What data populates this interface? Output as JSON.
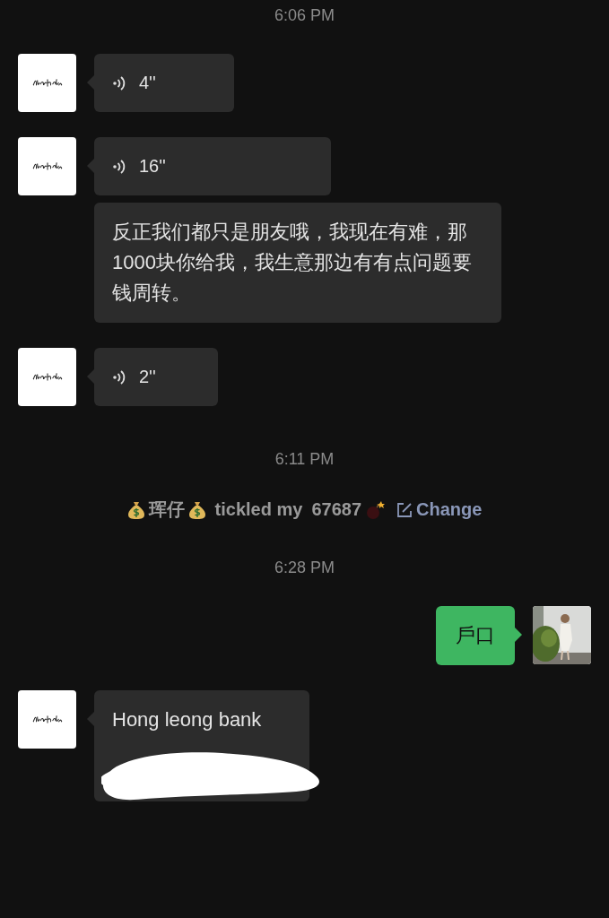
{
  "messages": [
    {
      "kind": "time",
      "text": "6:06 PM"
    },
    {
      "kind": "voice",
      "outgoing": false,
      "avatar": true,
      "duration": "4''"
    },
    {
      "kind": "voice",
      "outgoing": false,
      "avatar": true,
      "duration": "16''"
    },
    {
      "kind": "text",
      "outgoing": false,
      "avatar": false,
      "text": "反正我们都只是朋友哦，我现在有难，那1000块你给我，我生意那边有有点问题要钱周转。"
    },
    {
      "kind": "voice",
      "outgoing": false,
      "avatar": true,
      "duration": "2''"
    },
    {
      "kind": "time",
      "text": "6:11 PM"
    },
    {
      "kind": "tickle",
      "name": "珲仔",
      "action": "tickled my",
      "target": "67687",
      "link": "Change"
    },
    {
      "kind": "time",
      "text": "6:28 PM"
    },
    {
      "kind": "text",
      "outgoing": true,
      "avatar": true,
      "text": "戶口"
    },
    {
      "kind": "text",
      "outgoing": false,
      "avatar": true,
      "text": "Hong leong bank",
      "redacted": true
    }
  ]
}
